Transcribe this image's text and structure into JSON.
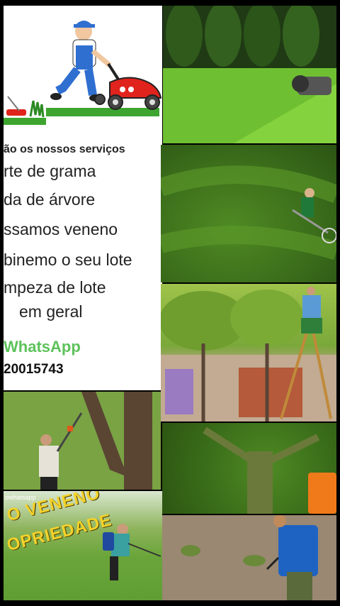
{
  "panel": {
    "heading": "ão os nossos serviços",
    "services": [
      "rte de grama",
      "da de árvore",
      "ssamos veneno",
      "binemo o seu lote",
      "mpeza de lote",
      "em geral"
    ],
    "whatsapp_label": "WhatsApp",
    "phone": "20015743"
  },
  "photos": {
    "poison_tag": "owhatsapp",
    "poison_line1": "O VENENO",
    "poison_line2": "OPRIEDADE"
  },
  "colors": {
    "whatsapp_green": "#5cc25a",
    "poison_yellow": "#f3d22a",
    "mower_red": "#e0231c",
    "overall_blue": "#2f6fd0"
  }
}
